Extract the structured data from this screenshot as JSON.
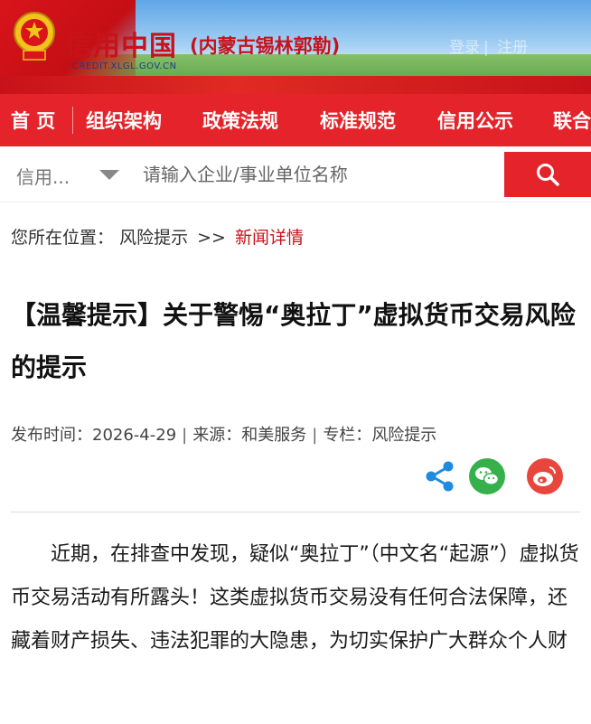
{
  "header": {
    "site_name": "信用中国",
    "site_region": "(内蒙古锡林郭勒)",
    "site_domain": "CREDIT.XLGL.GOV.CN",
    "login_label": "登录",
    "register_label": "注册"
  },
  "nav": {
    "items": [
      "首 页",
      "组织架构",
      "政策法规",
      "标准规范",
      "信用公示",
      "联合"
    ]
  },
  "search": {
    "scope_label": "信用...",
    "placeholder": "请输入企业/事业单位名称"
  },
  "breadcrumb": {
    "prefix": "您所在位置：",
    "section": "风险提示",
    "separator": ">>",
    "current": "新闻详情"
  },
  "article": {
    "title": "【温馨提示】关于警惕“奥拉丁”虚拟货币交易风险的提示",
    "publish_label": "发布时间：",
    "publish_date": "2026-4-29",
    "source_label": "来源：",
    "source": "和美服务",
    "column_label": "专栏：",
    "column": "风险提示",
    "body": "近期，在排查中发现，疑似“奥拉丁”（中文名“起源”）虚拟货币交易活动有所露头！这类虚拟货币交易没有任何合法保障，还藏着财产损失、违法犯罪的大隐患，为切实保护广大群众个人财"
  },
  "share": {
    "icons": [
      "share-icon",
      "wechat-icon",
      "weibo-icon"
    ]
  },
  "colors": {
    "brand_red": "#e4232a",
    "title_red": "#c8121a",
    "share_blue": "#1e8be0",
    "wechat_green": "#36b04b",
    "weibo_red": "#e8453c"
  }
}
